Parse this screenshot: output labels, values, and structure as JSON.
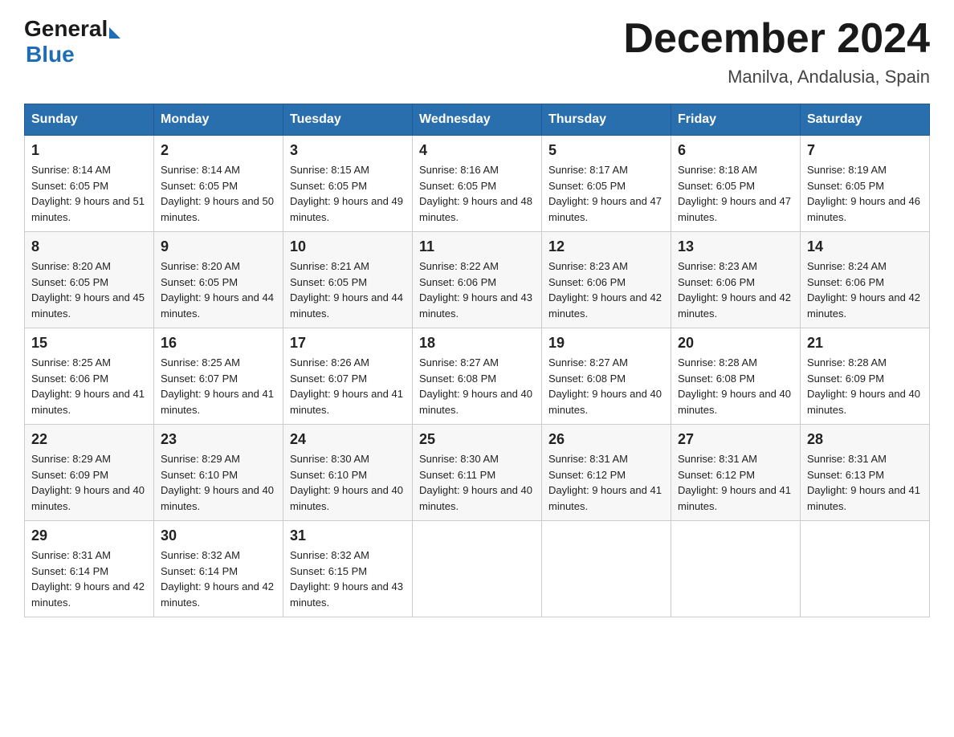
{
  "header": {
    "logo_general": "General",
    "logo_blue": "Blue",
    "month_title": "December 2024",
    "location": "Manilva, Andalusia, Spain"
  },
  "days_of_week": [
    "Sunday",
    "Monday",
    "Tuesday",
    "Wednesday",
    "Thursday",
    "Friday",
    "Saturday"
  ],
  "weeks": [
    [
      {
        "day": "1",
        "sunrise": "8:14 AM",
        "sunset": "6:05 PM",
        "daylight": "9 hours and 51 minutes."
      },
      {
        "day": "2",
        "sunrise": "8:14 AM",
        "sunset": "6:05 PM",
        "daylight": "9 hours and 50 minutes."
      },
      {
        "day": "3",
        "sunrise": "8:15 AM",
        "sunset": "6:05 PM",
        "daylight": "9 hours and 49 minutes."
      },
      {
        "day": "4",
        "sunrise": "8:16 AM",
        "sunset": "6:05 PM",
        "daylight": "9 hours and 48 minutes."
      },
      {
        "day": "5",
        "sunrise": "8:17 AM",
        "sunset": "6:05 PM",
        "daylight": "9 hours and 47 minutes."
      },
      {
        "day": "6",
        "sunrise": "8:18 AM",
        "sunset": "6:05 PM",
        "daylight": "9 hours and 47 minutes."
      },
      {
        "day": "7",
        "sunrise": "8:19 AM",
        "sunset": "6:05 PM",
        "daylight": "9 hours and 46 minutes."
      }
    ],
    [
      {
        "day": "8",
        "sunrise": "8:20 AM",
        "sunset": "6:05 PM",
        "daylight": "9 hours and 45 minutes."
      },
      {
        "day": "9",
        "sunrise": "8:20 AM",
        "sunset": "6:05 PM",
        "daylight": "9 hours and 44 minutes."
      },
      {
        "day": "10",
        "sunrise": "8:21 AM",
        "sunset": "6:05 PM",
        "daylight": "9 hours and 44 minutes."
      },
      {
        "day": "11",
        "sunrise": "8:22 AM",
        "sunset": "6:06 PM",
        "daylight": "9 hours and 43 minutes."
      },
      {
        "day": "12",
        "sunrise": "8:23 AM",
        "sunset": "6:06 PM",
        "daylight": "9 hours and 42 minutes."
      },
      {
        "day": "13",
        "sunrise": "8:23 AM",
        "sunset": "6:06 PM",
        "daylight": "9 hours and 42 minutes."
      },
      {
        "day": "14",
        "sunrise": "8:24 AM",
        "sunset": "6:06 PM",
        "daylight": "9 hours and 42 minutes."
      }
    ],
    [
      {
        "day": "15",
        "sunrise": "8:25 AM",
        "sunset": "6:06 PM",
        "daylight": "9 hours and 41 minutes."
      },
      {
        "day": "16",
        "sunrise": "8:25 AM",
        "sunset": "6:07 PM",
        "daylight": "9 hours and 41 minutes."
      },
      {
        "day": "17",
        "sunrise": "8:26 AM",
        "sunset": "6:07 PM",
        "daylight": "9 hours and 41 minutes."
      },
      {
        "day": "18",
        "sunrise": "8:27 AM",
        "sunset": "6:08 PM",
        "daylight": "9 hours and 40 minutes."
      },
      {
        "day": "19",
        "sunrise": "8:27 AM",
        "sunset": "6:08 PM",
        "daylight": "9 hours and 40 minutes."
      },
      {
        "day": "20",
        "sunrise": "8:28 AM",
        "sunset": "6:08 PM",
        "daylight": "9 hours and 40 minutes."
      },
      {
        "day": "21",
        "sunrise": "8:28 AM",
        "sunset": "6:09 PM",
        "daylight": "9 hours and 40 minutes."
      }
    ],
    [
      {
        "day": "22",
        "sunrise": "8:29 AM",
        "sunset": "6:09 PM",
        "daylight": "9 hours and 40 minutes."
      },
      {
        "day": "23",
        "sunrise": "8:29 AM",
        "sunset": "6:10 PM",
        "daylight": "9 hours and 40 minutes."
      },
      {
        "day": "24",
        "sunrise": "8:30 AM",
        "sunset": "6:10 PM",
        "daylight": "9 hours and 40 minutes."
      },
      {
        "day": "25",
        "sunrise": "8:30 AM",
        "sunset": "6:11 PM",
        "daylight": "9 hours and 40 minutes."
      },
      {
        "day": "26",
        "sunrise": "8:31 AM",
        "sunset": "6:12 PM",
        "daylight": "9 hours and 41 minutes."
      },
      {
        "day": "27",
        "sunrise": "8:31 AM",
        "sunset": "6:12 PM",
        "daylight": "9 hours and 41 minutes."
      },
      {
        "day": "28",
        "sunrise": "8:31 AM",
        "sunset": "6:13 PM",
        "daylight": "9 hours and 41 minutes."
      }
    ],
    [
      {
        "day": "29",
        "sunrise": "8:31 AM",
        "sunset": "6:14 PM",
        "daylight": "9 hours and 42 minutes."
      },
      {
        "day": "30",
        "sunrise": "8:32 AM",
        "sunset": "6:14 PM",
        "daylight": "9 hours and 42 minutes."
      },
      {
        "day": "31",
        "sunrise": "8:32 AM",
        "sunset": "6:15 PM",
        "daylight": "9 hours and 43 minutes."
      },
      null,
      null,
      null,
      null
    ]
  ]
}
